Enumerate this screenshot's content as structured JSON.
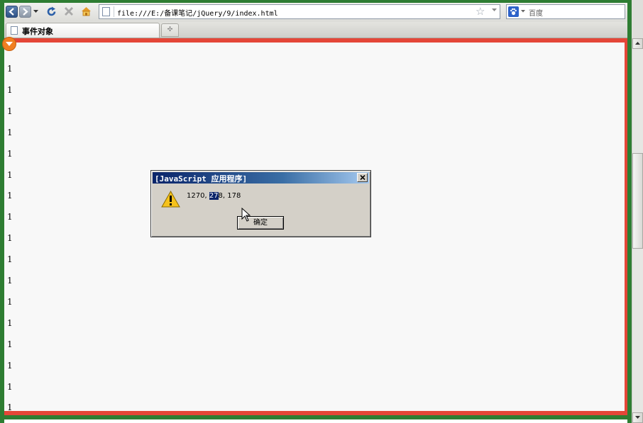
{
  "toolbar": {
    "url": "file:///E:/备课笔记/jQuery/9/index.html",
    "search_placeholder": "百度",
    "icons": [
      "back-icon",
      "forward-icon",
      "refresh-icon",
      "stop-icon",
      "home-icon",
      "bookmark-star-icon",
      "search-engine-icon"
    ]
  },
  "tabs": [
    {
      "label": "事件对象"
    }
  ],
  "page": {
    "lines": [
      "1",
      "1",
      "1",
      "1",
      "1",
      "1",
      "1",
      "1",
      "1",
      "1",
      "1",
      "1",
      "1",
      "1",
      "1",
      "1",
      "1"
    ]
  },
  "dialog": {
    "title": "[JavaScript 应用程序]",
    "message_prefix": "1270, ",
    "message_selected": "27",
    "message_suffix": "8, 178",
    "ok_label": "确定",
    "icon": "warning-icon"
  },
  "colors": {
    "frame_green": "#2e7d32",
    "border_red": "#e44638",
    "firebug_orange": "#f07f22",
    "dialog_title_dark": "#0a246a"
  }
}
